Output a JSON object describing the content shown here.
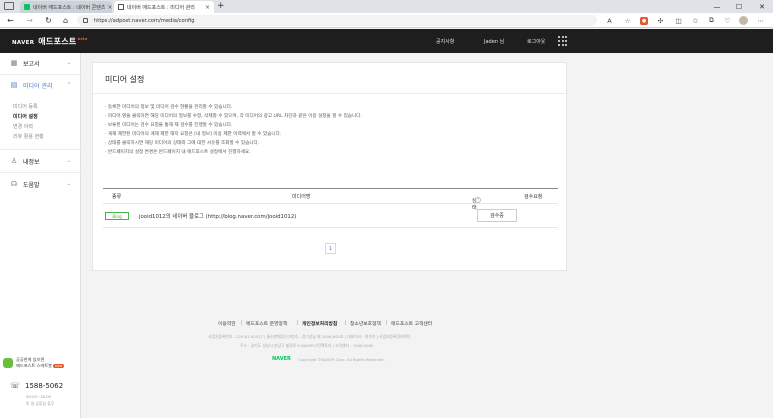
{
  "browser": {
    "tabs": [
      {
        "title": "네이버 애드포스트 : 네이버 콘텐츠"
      },
      {
        "title": "네이버 애드포스트 : 미디어 관리"
      }
    ],
    "url": "https://adpost.naver.com/media/config",
    "icons": {
      "sidebar": "sidebar-icon",
      "back": "back-icon",
      "forward": "forward-icon",
      "refresh": "refresh-icon",
      "home": "home-icon",
      "close": "close-icon",
      "new_tab": "plus-icon"
    }
  },
  "header": {
    "brand": "NAVER",
    "title": "애드포스트",
    "badge": "beta",
    "links": [
      "공지사항",
      "Jaden 님",
      "로그아웃"
    ]
  },
  "sidebar": {
    "sections": [
      {
        "label": "보고서",
        "icon": "chart-icon"
      },
      {
        "label": "미디어 관리",
        "icon": "media-icon",
        "active": true
      },
      {
        "label": "내정보",
        "icon": "person-icon"
      },
      {
        "label": "도움말",
        "icon": "headset-icon"
      }
    ],
    "subitems": [
      "미디어 등록",
      "미디어 설정",
      "변경 이력",
      "리뷰 활용 현황"
    ],
    "active_subitem": "미디어 설정",
    "promo": {
      "line1": "공공한게 있으면",
      "line2": "애드포스트 스마트봇",
      "badge": "new"
    },
    "phone": "1588-5062",
    "hours": "09:00~18:00",
    "hours_note": "토·일·공휴일 휴무"
  },
  "main": {
    "title": "미디어 설정",
    "descriptions": [
      "· 등록한 미디어의 정보 및 미디어 검수 현황을 관리할 수 있습니다.",
      "· 미디어 명을 클릭하면 해당 미디어의 정보를 수정, 삭제할 수 있으며, 각 미디어의 광고 URL 차단과 같은 이용 설정을 할 수 있습니다.",
      "· 보류된 미디어는 검수 요청을 통해 재 검수를 진행할 수 있습니다.",
      "· 게재 제한된 미디어의 게재 제한 해지 요청은 [내 정보] 이용 제한 이력에서 할 수 있습니다.",
      "· 상태를 클릭하시면 해당 미디어의 상태와 그에 대한 사유를 조회할 수 있습니다.",
      "· 반드페이지의 설정 변경은 반드페이지 내 애드포스트 설정에서 진행하세요."
    ],
    "table": {
      "columns": [
        "종류",
        "미디어명",
        "상태",
        "검수요청"
      ],
      "rows": [
        {
          "type": "Blog",
          "name": "jooid1012의 네이버 블로그 (http://blog.naver.com/jooid1012)",
          "status": "검수중",
          "request": ""
        }
      ]
    },
    "pagination": {
      "current": "1"
    }
  },
  "footer": {
    "links": [
      "이용약관",
      "애드포스트 운영정책",
      "개인정보처리방침",
      "청소년보호정책",
      "애드포스트 고객센터"
    ],
    "info1": "사업자등록번호 : 220-81-62517  |  통신판매업신고번호 : 경기성남 제 2006-692호  |  대표이사 : 최수연  |  사업자등록정보확인",
    "info2": "주소 : 경기도 성남시 분당구 불정로 6 NAVER그린팩토리  |  고객센터 : 1588-5062",
    "brand": "NAVER",
    "copyright": "Copyright ©NAVER Corp. All Rights Reserved."
  }
}
